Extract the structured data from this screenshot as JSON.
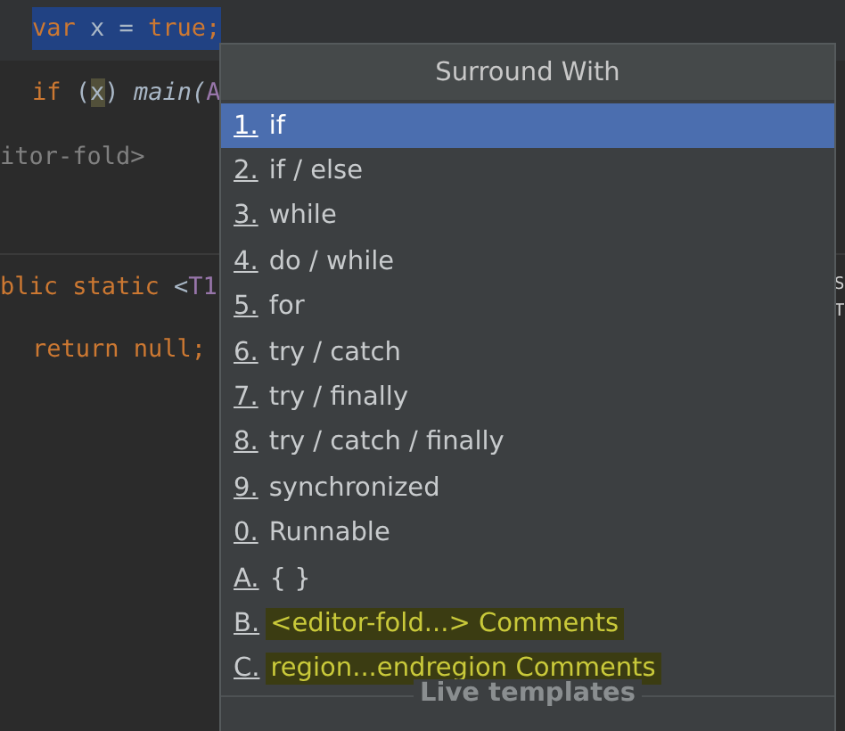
{
  "editor": {
    "lines": [
      {
        "indented": true,
        "selected": true,
        "separator_above": false,
        "tokens": [
          {
            "text": "var",
            "kind": "keyword"
          },
          {
            "text": " x = ",
            "kind": "plain"
          },
          {
            "text": "true;",
            "kind": "keyword"
          }
        ]
      },
      {
        "indented": true,
        "selected": false,
        "separator_above": false,
        "tokens": [
          {
            "text": "if",
            "kind": "keyword"
          },
          {
            "text": " (",
            "kind": "plain"
          },
          {
            "text": "x",
            "kind": "usage"
          },
          {
            "text": ") ",
            "kind": "plain"
          },
          {
            "text": "main(",
            "kind": "italic"
          },
          {
            "text": "A",
            "kind": "param"
          }
        ]
      },
      {
        "indented": false,
        "selected": false,
        "separator_above": false,
        "tokens": [
          {
            "text": "itor-fold>",
            "kind": "comment"
          }
        ]
      },
      {
        "separator_above": false
      },
      {
        "indented": false,
        "selected": false,
        "separator_above": true,
        "tokens": [
          {
            "text": "blic static",
            "kind": "keyword"
          },
          {
            "text": " <",
            "kind": "plain"
          },
          {
            "text": "T1",
            "kind": "param"
          }
        ]
      },
      {
        "indented": true,
        "selected": false,
        "separator_above": false,
        "tokens": [
          {
            "text": "return null;",
            "kind": "keyword"
          }
        ]
      }
    ],
    "edge_texts": [
      "S",
      "T"
    ]
  },
  "popup": {
    "title": "Surround With",
    "items": [
      {
        "mnemonic": "1.",
        "label": "if",
        "selected": true,
        "highlighted": false
      },
      {
        "mnemonic": "2.",
        "label": "if / else",
        "selected": false,
        "highlighted": false
      },
      {
        "mnemonic": "3.",
        "label": "while",
        "selected": false,
        "highlighted": false
      },
      {
        "mnemonic": "4.",
        "label": "do / while",
        "selected": false,
        "highlighted": false
      },
      {
        "mnemonic": "5.",
        "label": "for",
        "selected": false,
        "highlighted": false
      },
      {
        "mnemonic": "6.",
        "label": "try / catch",
        "selected": false,
        "highlighted": false
      },
      {
        "mnemonic": "7.",
        "label": "try / finally",
        "selected": false,
        "highlighted": false
      },
      {
        "mnemonic": "8.",
        "label": "try / catch / finally",
        "selected": false,
        "highlighted": false
      },
      {
        "mnemonic": "9.",
        "label": "synchronized",
        "selected": false,
        "highlighted": false
      },
      {
        "mnemonic": "0.",
        "label": "Runnable",
        "selected": false,
        "highlighted": false
      },
      {
        "mnemonic": "A.",
        "label": "{ }",
        "selected": false,
        "highlighted": false
      },
      {
        "mnemonic": "B.",
        "label": "<editor-fold...> Comments",
        "selected": false,
        "highlighted": true
      },
      {
        "mnemonic": "C.",
        "label": "region...endregion Comments",
        "selected": false,
        "highlighted": true
      }
    ],
    "section": "Live templates"
  }
}
